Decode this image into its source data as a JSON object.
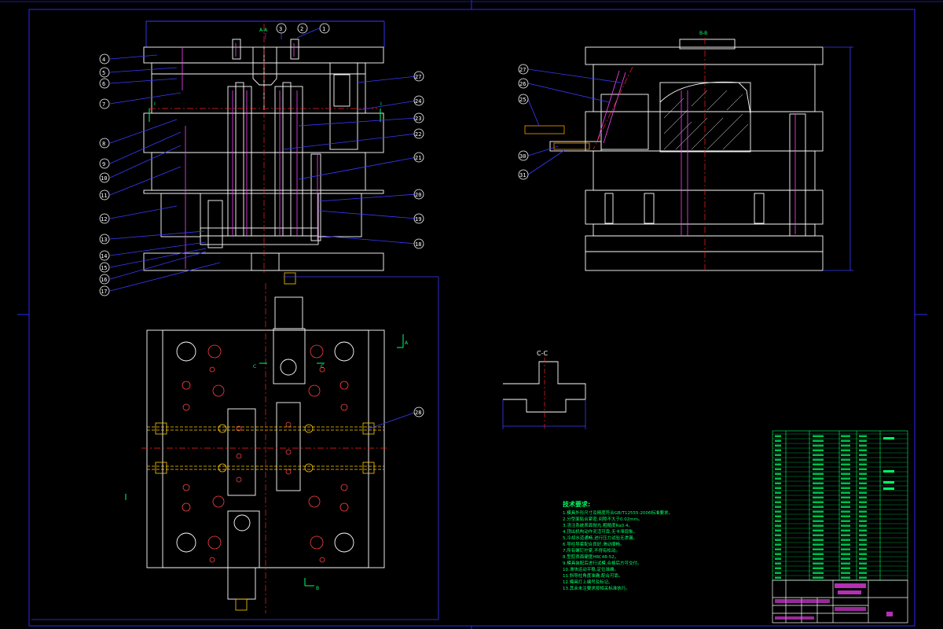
{
  "drawing": {
    "colors": {
      "background": "#000000",
      "frame": "#2a2aff",
      "outline": "#ffffff",
      "centerline": "#ff2020",
      "pin": "#ff44ff",
      "cooling": "#ffcc00",
      "notes": "#00ff66",
      "leader": "#3a3aff"
    },
    "section_labels": {
      "top_section": "A-A",
      "right_section": "B-B",
      "detail": "C-C",
      "marker_I": "I",
      "marker_A": "A",
      "marker_B": "B",
      "marker_C": "C"
    },
    "part_numbers_left": [
      "4",
      "5",
      "6",
      "7",
      "8",
      "9",
      "10",
      "11",
      "12",
      "13",
      "14",
      "15",
      "16",
      "17"
    ],
    "part_numbers_top": [
      "3",
      "2",
      "1"
    ],
    "part_numbers_right": [
      "27",
      "24",
      "23",
      "22",
      "21",
      "20",
      "19",
      "18"
    ],
    "part_numbers_rightview": [
      "27",
      "26",
      "25",
      "30",
      "31"
    ],
    "part_number_bottom": "28",
    "notes_title": "技术要求:",
    "notes_lines": [
      "1.模具外形尺寸及精度符合GB/T12555-2006标准要求。",
      "2.分型面贴合紧密,间隙不大于0.02mm。",
      "3.浇注系统表面抛光,粗糙度Ra0.4。",
      "4.顶出机构动作灵活可靠,无卡滞现象。",
      "5.冷却水道通畅,进行压力试验无渗漏。",
      "6.导柱导套配合良好,滑动顺畅。",
      "7.所有螺钉拧紧,不得有松动。",
      "8.型腔表面硬度HRC48-52。",
      "9.模具装配后进行试模,合格后方可交付。",
      "10.滑块运动平稳,定位准确。",
      "11.斜导柱角度准确,配合可靠。",
      "12.模具打上编号及标记。",
      "13.其余未注要求按相关标准执行。"
    ]
  }
}
